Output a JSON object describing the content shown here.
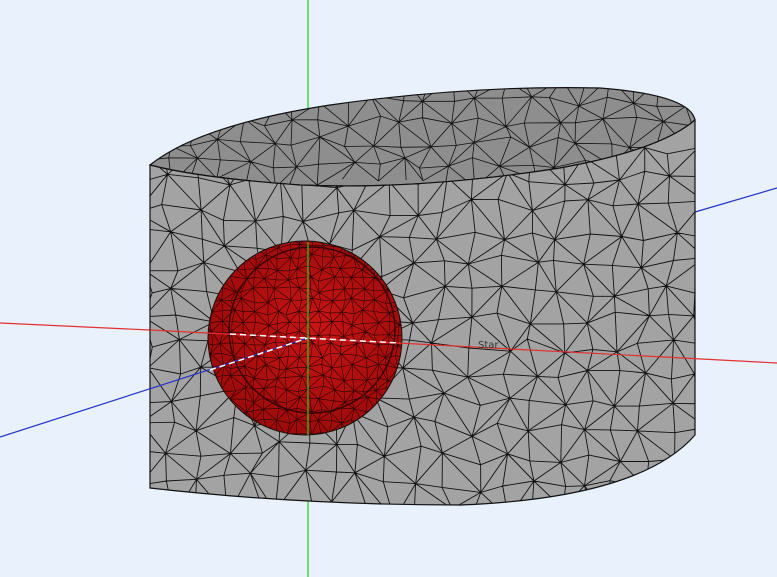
{
  "viewport": {
    "background": "#e8f1fc"
  },
  "annotations": {
    "star_label": "Star"
  },
  "colors": {
    "body_fill": "#a3a3a3",
    "body_top": "#8e8e8e",
    "mesh_line": "#111111",
    "sphere_fill": "#b80f0f",
    "sphere_dark": "#6e0505",
    "x_axis": "#e03030",
    "y_axis": "#22cc22",
    "z_axis": "#2233cc"
  }
}
